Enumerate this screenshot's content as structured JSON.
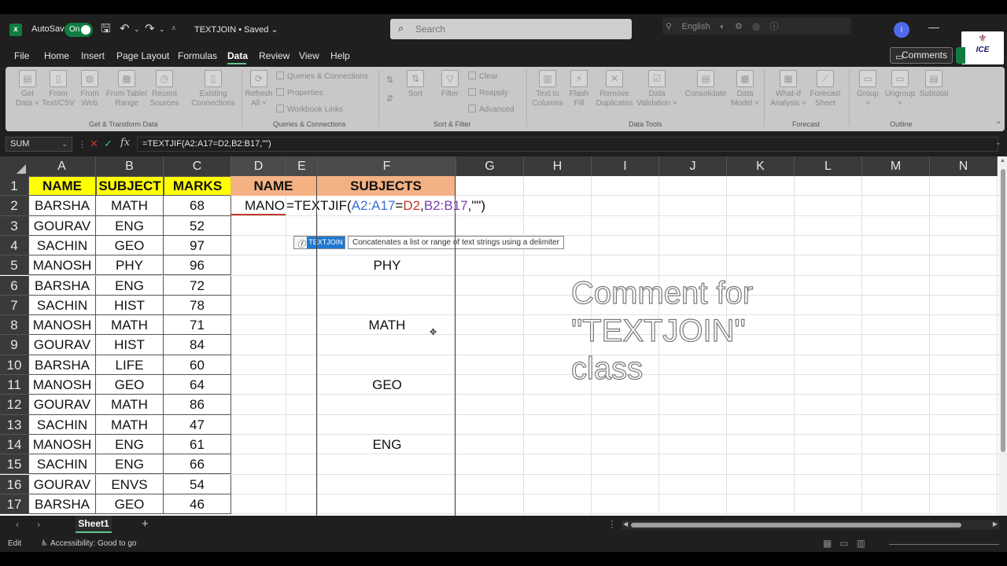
{
  "titlebar": {
    "autosave_label": "AutoSave",
    "autosave_state": "On",
    "doc_title": "TEXTJOIN • Saved ⌄",
    "search_placeholder": "Search",
    "avatar_initial": "I",
    "toolstrip_label": "English",
    "logo_text": "ICE"
  },
  "menu": {
    "tabs": [
      "File",
      "Home",
      "Insert",
      "Page Layout",
      "Formulas",
      "Data",
      "Review",
      "View",
      "Help"
    ],
    "active_tab": "Data",
    "comments_label": "Comments"
  },
  "ribbon": {
    "get_transform": {
      "label": "Get & Transform Data",
      "buttons": [
        "Get\nData ˅",
        "From\nText/CSV",
        "From\nWeb",
        "From Table/\nRange",
        "Recent\nSources",
        "Existing\nConnections"
      ]
    },
    "queries": {
      "label": "Queries & Connections",
      "refresh": "Refresh\nAll ˅",
      "items": [
        "Queries & Connections",
        "Properties",
        "Workbook Links"
      ]
    },
    "sort_filter": {
      "label": "Sort & Filter",
      "sort": "Sort",
      "filter": "Filter",
      "items": [
        "Clear",
        "Reapply",
        "Advanced"
      ]
    },
    "data_tools": {
      "label": "Data Tools",
      "buttons": [
        "Text to\nColumns",
        "Flash\nFill",
        "Remove\nDuplicates",
        "Data\nValidation ˅",
        "Consolidate",
        "Data\nModel ˅"
      ]
    },
    "forecast": {
      "label": "Forecast",
      "buttons": [
        "What-If\nAnalysis ˅",
        "Forecast\nSheet"
      ]
    },
    "outline": {
      "label": "Outline",
      "buttons": [
        "Group\n˅",
        "Ungroup\n˅",
        "Subtotal"
      ]
    }
  },
  "formula_bar": {
    "name_box": "SUM",
    "formula": "=TEXTJIF(A2:A17=D2,B2:B17,\"\")"
  },
  "grid": {
    "columns": [
      "A",
      "B",
      "C",
      "D",
      "E",
      "F",
      "G",
      "H",
      "I",
      "J",
      "K",
      "L",
      "M",
      "N"
    ],
    "rows": [
      "1",
      "2",
      "3",
      "4",
      "5",
      "6",
      "7",
      "8",
      "9",
      "10",
      "11",
      "12",
      "13",
      "14",
      "15",
      "16",
      "17"
    ],
    "headers": {
      "name": "NAME",
      "subject": "SUBJECT",
      "marks": "MARKS",
      "d_name": "NAME",
      "f_subjects": "SUBJECTS"
    },
    "data": [
      [
        "BARSHA",
        "MATH",
        "68"
      ],
      [
        "GOURAV",
        "ENG",
        "52"
      ],
      [
        "SACHIN",
        "GEO",
        "97"
      ],
      [
        "MANOSH",
        "PHY",
        "96"
      ],
      [
        "BARSHA",
        "ENG",
        "72"
      ],
      [
        "SACHIN",
        "HIST",
        "78"
      ],
      [
        "MANOSH",
        "MATH",
        "71"
      ],
      [
        "GOURAV",
        "HIST",
        "84"
      ],
      [
        "BARSHA",
        "LIFE",
        "60"
      ],
      [
        "MANOSH",
        "GEO",
        "64"
      ],
      [
        "GOURAV",
        "MATH",
        "86"
      ],
      [
        "SACHIN",
        "MATH",
        "47"
      ],
      [
        "MANOSH",
        "ENG",
        "61"
      ],
      [
        "SACHIN",
        "ENG",
        "66"
      ],
      [
        "GOURAV",
        "ENVS",
        "54"
      ],
      [
        "BARSHA",
        "GEO",
        "46"
      ]
    ],
    "d2_value": "MANO",
    "formula_parts": {
      "p1": "=TEXTJIF(",
      "r1": "A2:A17",
      "p2": "=",
      "r2": "D2",
      "p3": ",",
      "r3": "B2:B17",
      "p4": ",\"\")"
    },
    "f_results": [
      {
        "row": 5,
        "value": "PHY"
      },
      {
        "row": 8,
        "value": "MATH"
      },
      {
        "row": 11,
        "value": "GEO"
      },
      {
        "row": 14,
        "value": "ENG"
      }
    ],
    "tooltip": {
      "function": "TEXTJOIN",
      "description": "Concatenates a list or range of text strings using a delimiter"
    },
    "overlay_comment": "Comment for\n\"TEXTJOIN\"\nclass"
  },
  "sheets": {
    "tabs": [
      "Sheet1"
    ],
    "active": "Sheet1"
  },
  "status": {
    "mode": "Edit",
    "accessibility": "Accessibility: Good to go"
  },
  "colors": {
    "excel_green": "#107c41",
    "header_yellow": "#ffff00",
    "header_orange": "#f4b183",
    "ref_blue": "#3a6fd8",
    "ref_red": "#c0392b",
    "ref_purple": "#7b3fb0"
  }
}
